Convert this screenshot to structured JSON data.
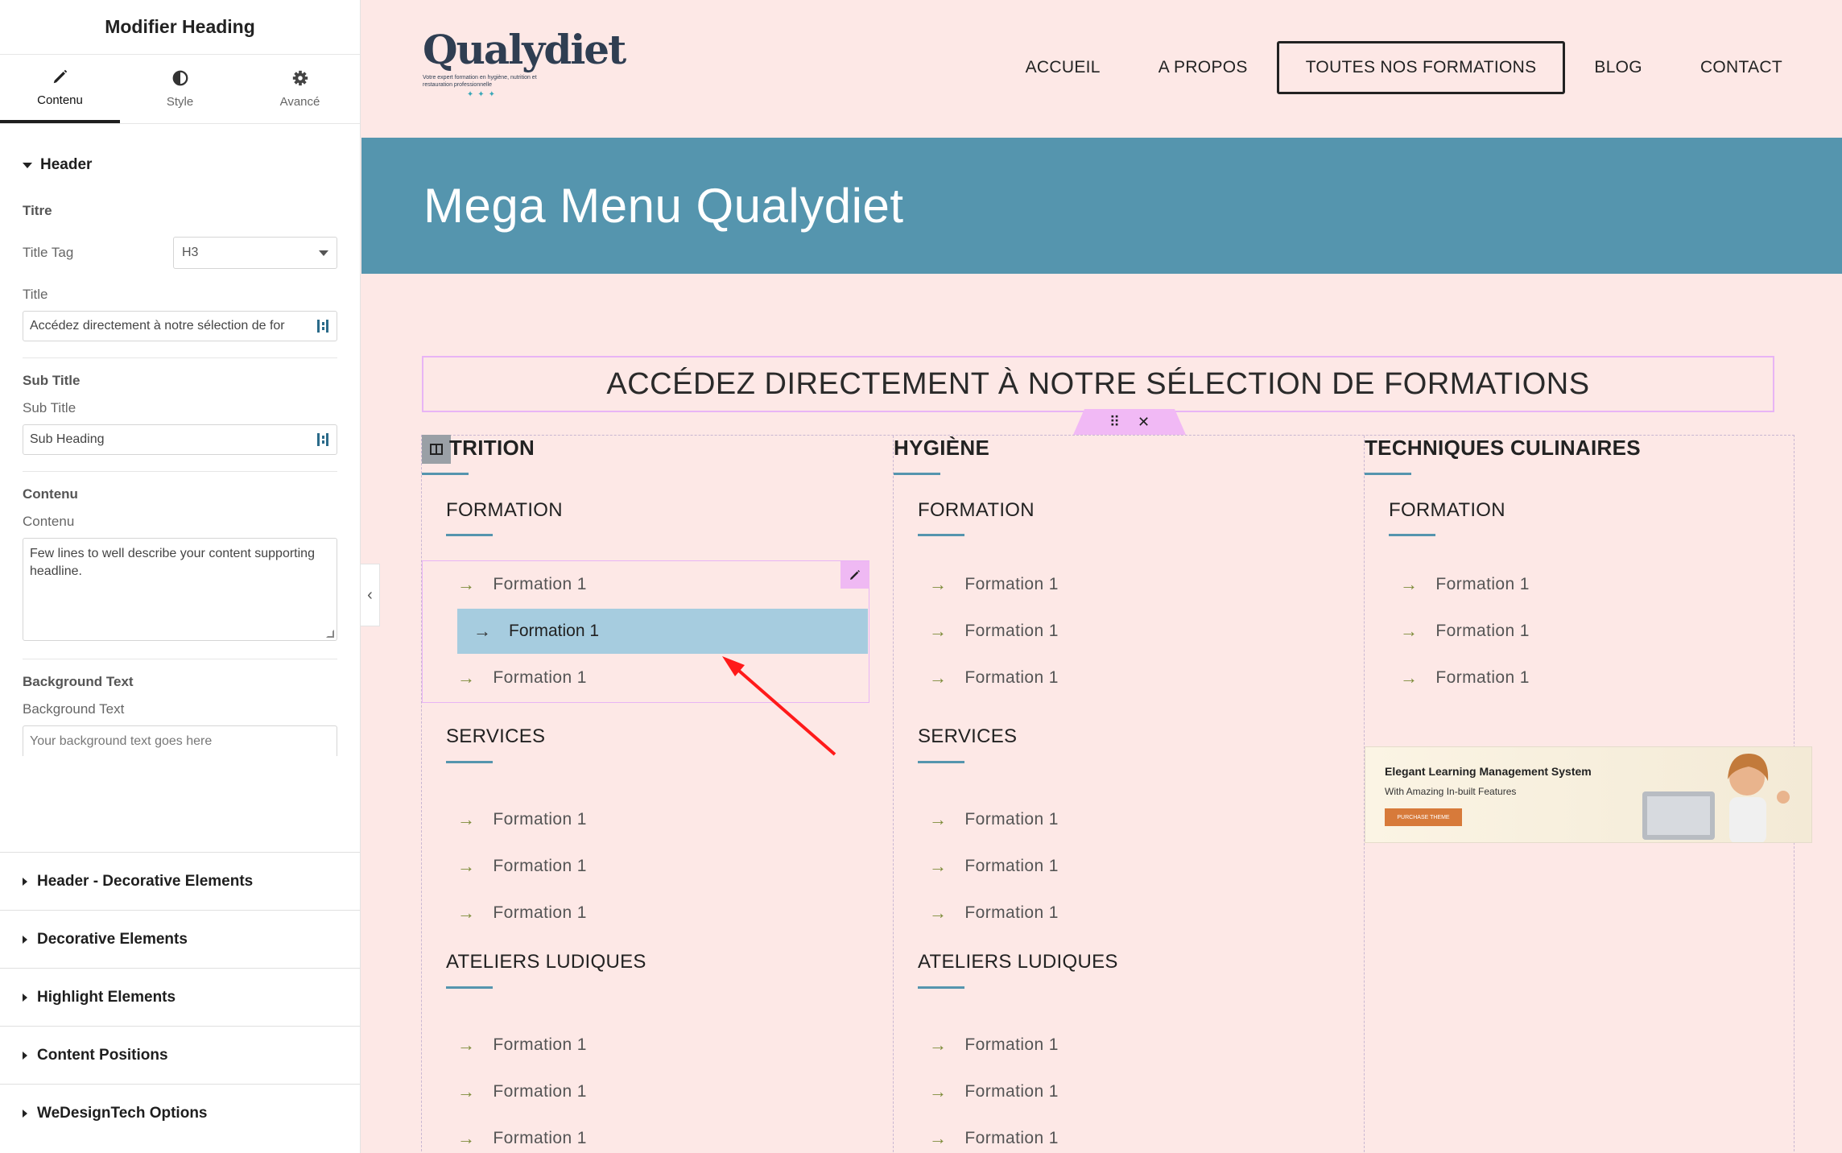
{
  "panel": {
    "title": "Modifier Heading",
    "tabs": [
      {
        "label": "Contenu",
        "icon": "pencil-icon"
      },
      {
        "label": "Style",
        "icon": "half-circle-icon"
      },
      {
        "label": "Avancé",
        "icon": "gear-icon"
      }
    ],
    "header_section": "Header",
    "titre_label": "Titre",
    "title_tag_label": "Title Tag",
    "title_tag_value": "H3",
    "title_label": "Title",
    "title_value": "Accédez directement à notre sélection de for",
    "subtitle_section": "Sub Title",
    "subtitle_label": "Sub Title",
    "subtitle_value": "Sub Heading",
    "contenu_section": "Contenu",
    "contenu_label": "Contenu",
    "contenu_value": "Few lines to well describe your content supporting headline.",
    "bgtext_section": "Background Text",
    "bgtext_label": "Background Text",
    "bgtext_placeholder": "Your background text goes here",
    "accordions": [
      "Header - Decorative Elements",
      "Decorative Elements",
      "Highlight Elements",
      "Content Positions",
      "WeDesignTech Options"
    ]
  },
  "site": {
    "logo_word": "Qualydiet",
    "logo_tagline": "Votre expert formation en hygiène, nutrition et restauration professionnelle",
    "nav": [
      "ACCUEIL",
      "A PROPOS",
      "TOUTES NOS FORMATIONS",
      "BLOG",
      "CONTACT"
    ],
    "banner_title": "Mega Menu Qualydiet",
    "heading": "ACCÉDEZ DIRECTEMENT À NOTRE SÉLECTION DE FORMATIONS",
    "columns": [
      {
        "title": "TRITION",
        "groups": [
          {
            "title": "FORMATION",
            "items": [
              "Formation 1",
              "Formation 1",
              "Formation 1"
            ]
          },
          {
            "title": "SERVICES",
            "items": [
              "Formation 1",
              "Formation 1",
              "Formation 1"
            ]
          },
          {
            "title": "ATELIERS LUDIQUES",
            "items": [
              "Formation 1",
              "Formation 1",
              "Formation 1"
            ]
          }
        ]
      },
      {
        "title": "HYGIÈNE",
        "groups": [
          {
            "title": "FORMATION",
            "items": [
              "Formation 1",
              "Formation 1",
              "Formation 1"
            ]
          },
          {
            "title": "SERVICES",
            "items": [
              "Formation 1",
              "Formation 1",
              "Formation 1"
            ]
          },
          {
            "title": "ATELIERS LUDIQUES",
            "items": [
              "Formation 1",
              "Formation 1",
              "Formation 1"
            ]
          }
        ]
      },
      {
        "title": "TECHNIQUES CULINAIRES",
        "groups": [
          {
            "title": "FORMATION",
            "items": [
              "Formation 1",
              "Formation 1",
              "Formation 1"
            ]
          }
        ],
        "ad": {
          "title": "Elegant Learning Management System",
          "subtitle": "With Amazing In-built Features",
          "button": "PURCHASE THEME"
        }
      }
    ]
  },
  "colors": {
    "page_bg": "#fde8e6",
    "banner": "#5595ae",
    "arrow": "#7d8c3a",
    "highlight": "#a6ccdf",
    "editor_outline": "#e8b4f5"
  }
}
